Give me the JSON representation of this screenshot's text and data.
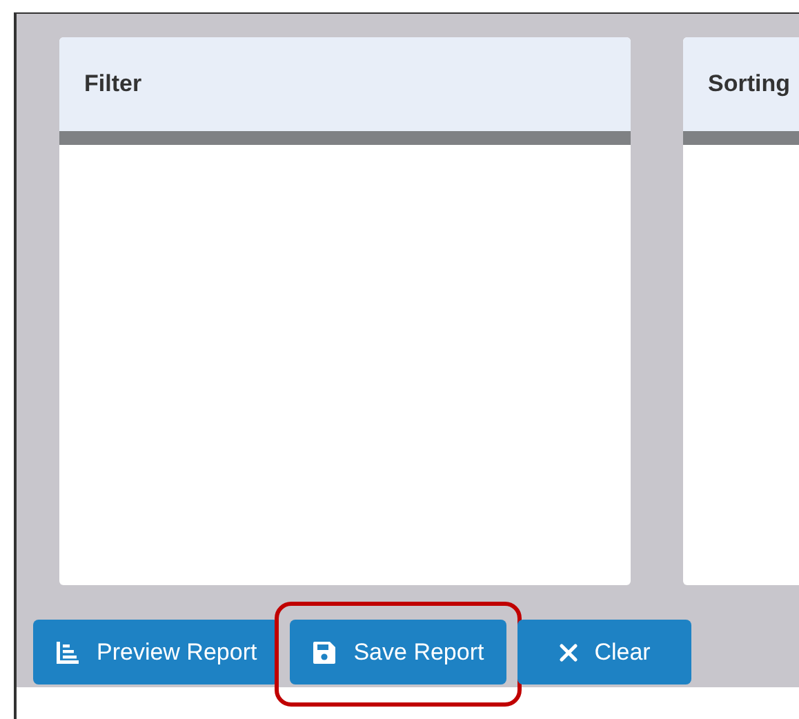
{
  "panels": [
    {
      "title": "Filter"
    },
    {
      "title": "Sorting"
    }
  ],
  "buttons": [
    {
      "label": "Preview Report",
      "kind": "preview",
      "highlighted": false
    },
    {
      "label": "Save Report",
      "kind": "save",
      "highlighted": true
    },
    {
      "label": "Clear",
      "kind": "clear",
      "highlighted": false
    }
  ]
}
